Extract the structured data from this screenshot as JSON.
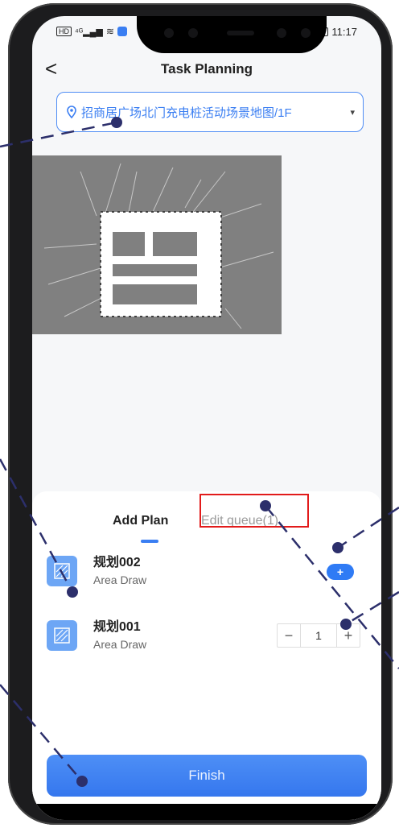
{
  "status": {
    "time": "11:17",
    "left_icons": [
      "HD",
      "4G",
      "signal",
      "wifi",
      "shield"
    ]
  },
  "header": {
    "back_label": "<",
    "title": "Task Planning"
  },
  "map_selector": {
    "label": "招商居广场北门充电桩活动场景地图/1F",
    "icon": "location-pin-icon",
    "caret": "▾"
  },
  "tabs": [
    {
      "label": "Add Plan",
      "active": true
    },
    {
      "label": "Edit queue(1)",
      "active": false
    }
  ],
  "plans": [
    {
      "name": "规划002",
      "type": "Area Draw",
      "action": "+"
    },
    {
      "name": "规划001",
      "type": "Area Draw",
      "stepper": {
        "minus": "−",
        "value": "1",
        "plus": "+"
      }
    }
  ],
  "footer": {
    "finish_label": "Finish"
  },
  "colors": {
    "accent": "#3a7ef2",
    "highlight": "#e21b1b",
    "annotation": "#2c2f6b"
  }
}
